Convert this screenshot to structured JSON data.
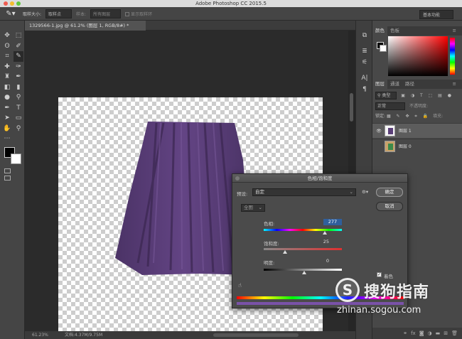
{
  "app": {
    "window_title": "Adobe Photoshop CC 2015.5"
  },
  "options_bar": {
    "sample_size_label": "取样大小:",
    "sample_size_value": "取样点",
    "sample_label": "样本:",
    "sample_value": "所有图层",
    "show_ring_label": "显示取样环",
    "workspace": "基本功能"
  },
  "document": {
    "tab_title": "1329566-1.jpg @ 61.2% (图层 1, RGB/8#) *",
    "zoom": "61.23%",
    "doc_info": "文档:4.37M/9.75M"
  },
  "color_panel": {
    "tabs": [
      "颜色",
      "色板"
    ]
  },
  "layers_panel": {
    "tabs": [
      "图层",
      "通道",
      "路径"
    ],
    "filter_kind": "类型",
    "blend_mode": "正常",
    "opacity_label": "不透明度:",
    "lock_label": "锁定:",
    "fill_label": "填充:",
    "layers": [
      {
        "name": "图层 1",
        "selected": true
      },
      {
        "name": "图层 0",
        "selected": false
      }
    ]
  },
  "hue_sat_dialog": {
    "title": "色相/饱和度",
    "preset_label": "预设:",
    "preset_value": "自定",
    "channel_value": "全图",
    "ok_label": "确定",
    "cancel_label": "取消",
    "hue": {
      "label": "色相:",
      "value": "277"
    },
    "saturation": {
      "label": "饱和度:",
      "value": "25"
    },
    "lightness": {
      "label": "明度:",
      "value": "0"
    },
    "colorize_label": "着色",
    "colorize_checked": true
  },
  "watermark": {
    "brand": "搜狗指南",
    "url": "zhinan.sogou.com"
  },
  "colors": {
    "skirt": "#5a3f78",
    "selection": "#2f5f9c"
  }
}
